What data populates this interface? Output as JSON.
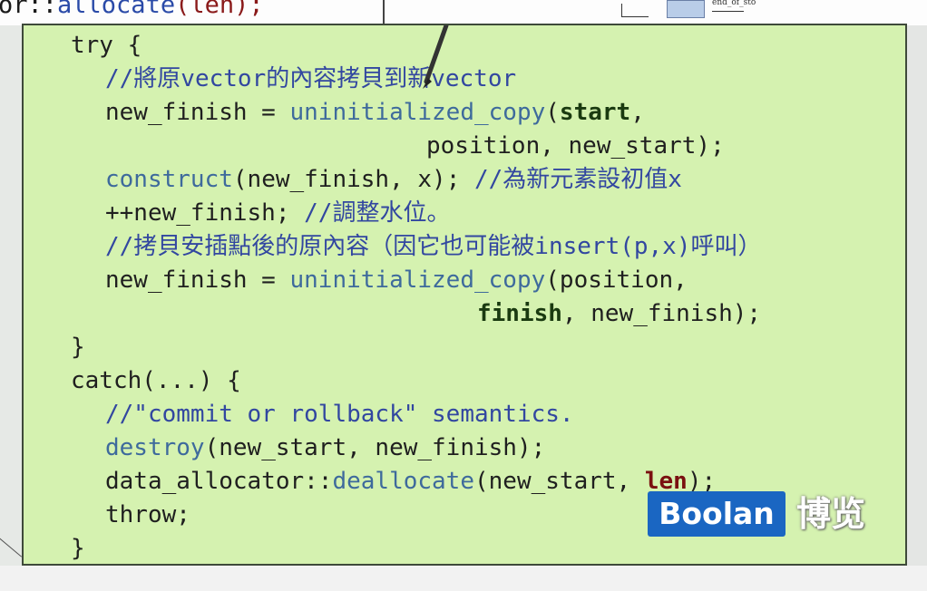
{
  "top_strip": {
    "code_prefix": "or::",
    "code_fn": "allocate",
    "code_args": "(len);",
    "diagram_label": "end_of_sto"
  },
  "code": {
    "line1": "try {",
    "line2_comment": "//將原vector的內容拷貝到新vector",
    "line3_a": "new_finish = ",
    "line3_fn": "uninitialized_copy",
    "line3_b": "(",
    "line3_bold": "start",
    "line3_c": ",",
    "line4": "position, new_start);",
    "line5_fn": "construct",
    "line5_b": "(new_finish, x); ",
    "line5_comment": "//為新元素設初值x",
    "line6_a": "++new_finish; ",
    "line6_comment": "//調整水位。",
    "line7_comment": "//拷貝安插點後的原內容（因它也可能被insert(p,x)呼叫）",
    "line8_a": "new_finish = ",
    "line8_fn": "uninitialized_copy",
    "line8_b": "(position,",
    "line9_bold": "finish",
    "line9_b": ", new_finish);",
    "line10": "}",
    "line11": "catch(...) {",
    "line12_comment": "//\"commit or rollback\" semantics.",
    "line13_fn": "destroy",
    "line13_b": "(new_start, new_finish);",
    "line14_a": "data_allocator::",
    "line14_fn": "deallocate",
    "line14_b": "(new_start, ",
    "line14_red": "len",
    "line14_c": ");",
    "line15": "throw;",
    "line16": "}"
  },
  "logo": {
    "badge_text": "Boolan",
    "cn_text": "博览"
  },
  "colors": {
    "slide_bg": "#d5f2b0",
    "comment": "#3247a0",
    "function": "#3e6a9c",
    "logo_blue": "#1a66c2"
  }
}
